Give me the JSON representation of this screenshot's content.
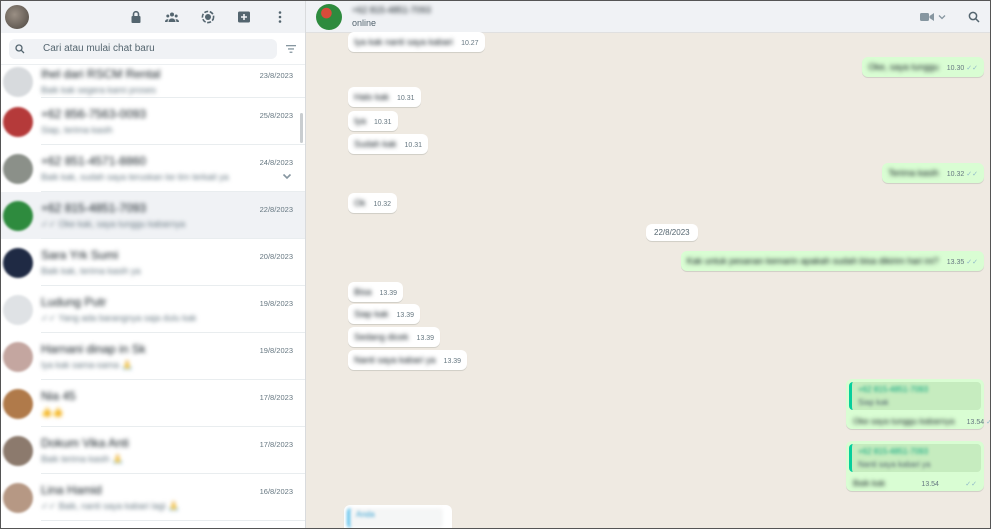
{
  "sidebar": {
    "search_placeholder": "Cari atau mulai chat baru",
    "chats": [
      {
        "name": "Ihel dari RSCM Rental",
        "preview": "Baik kak segera kami proses",
        "time": "23/8/2023",
        "avatar_color": "#d7dadd",
        "partial": true
      },
      {
        "name": "+62 856-7563-0093",
        "preview": "Siap, terima kasih",
        "time": "25/8/2023",
        "avatar_color": "#b53a3a"
      },
      {
        "name": "+62 851-4571-8860",
        "preview": "Baik kak, sudah saya teruskan ke tim terkait ya",
        "time": "24/8/2023",
        "avatar_color": "#8b9089",
        "chevron": true
      },
      {
        "name": "+62 815-4851-7093",
        "preview": "✓✓ Oke kak, saya tunggu kabarnya",
        "time": "22/8/2023",
        "avatar_color": "#2e8b3e",
        "selected": true
      },
      {
        "name": "Sara Yrk Sumi",
        "preview": "Baik kak, terima kasih ya",
        "time": "20/8/2023",
        "avatar_color": "#1f2a44"
      },
      {
        "name": "Ludung Putr",
        "preview": "✓✓ Yang ada barangnya saja dulu kak",
        "time": "19/8/2023",
        "avatar_color": "#dfe2e5"
      },
      {
        "name": "Harnani dinap in Sk",
        "preview": "Iya kak sama-sama 🙏",
        "time": "19/8/2023",
        "avatar_color": "#c4a6a0"
      },
      {
        "name": "Nia 45",
        "preview": "👍👍",
        "time": "17/8/2023",
        "avatar_color": "#b07a4a"
      },
      {
        "name": "Dokum Vika Anti",
        "preview": "Baik terima kasih 🙏",
        "time": "17/8/2023",
        "avatar_color": "#8c7a6d"
      },
      {
        "name": "Lina Hamid",
        "preview": "✓✓ Baik, nanti saya kabari lagi 🙏",
        "time": "16/8/2023",
        "avatar_color": "#b69884"
      }
    ]
  },
  "conversation": {
    "name": "+62 815-4851-7093",
    "status": "online",
    "date_chip": "22/8/2023",
    "messages": [
      {
        "dir": "in",
        "text": "Iya kak nanti saya kabari",
        "time": "10.27"
      },
      {
        "dir": "out",
        "text": "Oke, saya tunggu",
        "time": "10.30"
      },
      {
        "dir": "in",
        "text": "Halo kak",
        "time": "10.31"
      },
      {
        "dir": "in",
        "text": "Iya",
        "time": "10.31"
      },
      {
        "dir": "in",
        "text": "Sudah kak",
        "time": "10.31"
      },
      {
        "dir": "out",
        "text": "Terima kasih",
        "time": "10.32"
      },
      {
        "dir": "in",
        "text": "Ok",
        "time": "10.32"
      },
      {
        "dir": "out",
        "text": "Kak untuk pesanan kemarin apakah sudah bisa dikirim hari ini?",
        "time": "13.35"
      },
      {
        "dir": "in",
        "text": "Bisa",
        "time": "13.39"
      },
      {
        "dir": "in",
        "text": "Siap kak",
        "time": "13.39"
      },
      {
        "dir": "in",
        "text": "Sedang dicek",
        "time": "13.39"
      },
      {
        "dir": "in",
        "text": "Nanti saya kabari ya",
        "time": "13.39"
      }
    ],
    "quotes": [
      {
        "qname": "+62 815-4851-7093",
        "qtext": "Siap kak",
        "text": "Oke saya tunggu kabarnya",
        "time": "13.54"
      },
      {
        "qname": "+62 815-4851-7093",
        "qtext": "Nanti saya kabari ya",
        "text": "Baik kak",
        "time": "13.54"
      }
    ],
    "incoming_quote": {
      "qname": "Anda"
    }
  },
  "colors": {
    "outgoing_bubble": "#d9fdd3",
    "incoming_bubble": "#ffffff",
    "chat_background": "#efeae2",
    "header_background": "#f0f2f5",
    "quote_accent": "#06cf9c"
  },
  "icons": {
    "header": [
      "lock-icon",
      "communities-icon",
      "status-icon",
      "new-chat-icon",
      "menu-icon"
    ],
    "conversation": [
      "video-call-icon",
      "chevron-down-icon",
      "search-icon"
    ]
  }
}
